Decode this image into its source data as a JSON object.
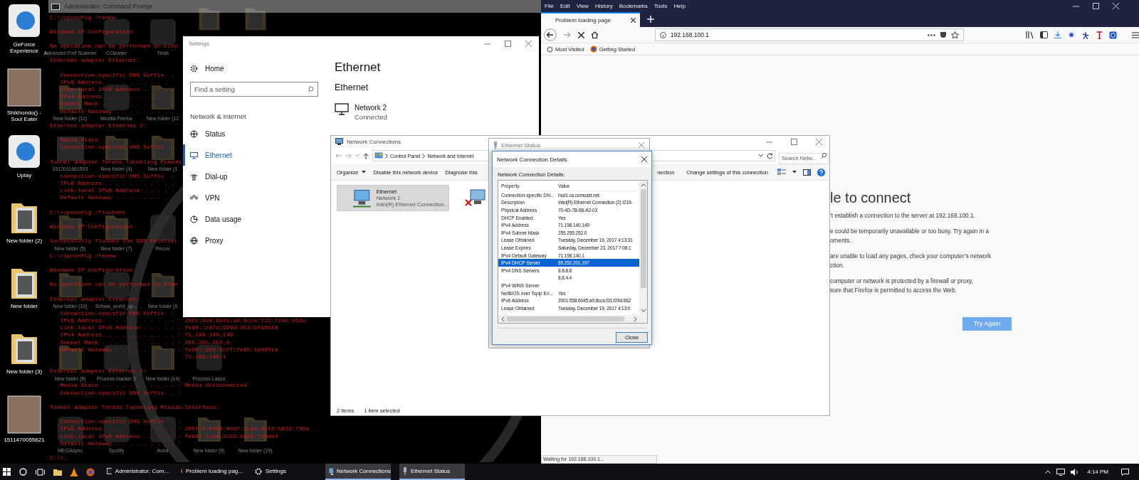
{
  "desktop_icons": [
    {
      "label": "GeForce Experience",
      "kind": "app"
    },
    {
      "label": "Shikhondo() - Soul Eater",
      "kind": "photo"
    },
    {
      "label": "Uplay",
      "kind": "app"
    },
    {
      "label": "New folder (2)",
      "kind": "folder"
    },
    {
      "label": "New folder",
      "kind": "folder"
    },
    {
      "label": "New folder (3)",
      "kind": "folder"
    },
    {
      "label": "1511470055621",
      "kind": "photo"
    }
  ],
  "background_icons": [
    [
      {
        "label": "Advanced Port Scanner",
        "kind": "app"
      },
      {
        "label": "CCleaner",
        "kind": "app"
      },
      {
        "label": "Tixati",
        "kind": "app"
      },
      {
        "kind": "folder"
      },
      {
        "kind": "folder"
      }
    ],
    [
      {
        "label": "New folder (11)",
        "kind": "folder"
      },
      {
        "label": "Mozilla Firefox",
        "kind": "app"
      },
      {
        "label": "New folder (12",
        "kind": "folder"
      }
    ],
    [
      {
        "label": "1512011661593",
        "kind": "photo"
      },
      {
        "label": "New folder (4)",
        "kind": "folder"
      },
      {
        "label": "New folder (1",
        "kind": "folder"
      }
    ],
    [
      {
        "label": "New folder (5)",
        "kind": "folder"
      },
      {
        "label": "New folder (7)",
        "kind": "folder"
      },
      {
        "label": "Recuv",
        "kind": "app"
      }
    ],
    [
      {
        "label": "New folder (10)",
        "kind": "folder"
      },
      {
        "label": "Schwa_world_op...",
        "kind": "app"
      },
      {
        "label": "New folder (6",
        "kind": "folder"
      }
    ],
    [
      {
        "label": "New folder (8)",
        "kind": "folder"
      },
      {
        "label": "Process Hacker 2",
        "kind": "app"
      },
      {
        "label": "New folder (14)",
        "kind": "folder"
      },
      {
        "label": "Process Lasso",
        "kind": "app"
      }
    ],
    [
      {
        "label": "MEGAsync",
        "kind": "app"
      },
      {
        "label": "Spotify",
        "kind": "app"
      },
      {
        "label": "Avira",
        "kind": "app"
      },
      {
        "label": "New folder (9)",
        "kind": "folder"
      },
      {
        "label": "New folder (19)",
        "kind": "folder"
      }
    ]
  ],
  "command_prompt": {
    "title": "Administrator: Command Prompt",
    "blocks": [
      {
        "indented": false,
        "lines": [
          "C:\\>ipconfig /renew"
        ]
      },
      {
        "indented": false,
        "lines": [
          "Windows IP Configuration"
        ]
      },
      {
        "indented": false,
        "lines": [
          "No operation can be performed on Ethe"
        ]
      },
      {
        "indented": false,
        "lines": [
          "Ethernet adapter Ethernet:"
        ]
      },
      {
        "indented": true,
        "lines": [
          "Connection-specific DNS Suffix  .",
          "IPv6 Address. . . . . . . . . .",
          "Link-local IPv6 Address . . . . .",
          "IPv4 Address. . . . . . . . . . .",
          "Subnet Mask . . . . . . . . . . .",
          "Default Gateway . . . . . . . . ."
        ]
      },
      {
        "indented": false,
        "lines": [
          "Ethernet adapter Ethernet 2:"
        ]
      },
      {
        "indented": true,
        "lines": [
          "Media State . . . . . . . . . . .",
          "Connection-specific DNS Suffix  ."
        ]
      },
      {
        "indented": false,
        "lines": [
          "Tunnel adapter Teredo Tunneling Pseudo"
        ]
      },
      {
        "indented": true,
        "lines": [
          "Connection-specific DNS Suffix  .",
          "IPv6 Address. . . . . . . . . . .",
          "Link-local IPv6 Address . . . . .",
          "Default Gateway . . . . . . . . ."
        ]
      },
      {
        "indented": false,
        "lines": [
          "C:\\>ipconfig /flushdns"
        ]
      },
      {
        "indented": false,
        "lines": [
          "Windows IP Configuration"
        ]
      },
      {
        "indented": false,
        "lines": [
          "Successfully flushed the DNS Resolver"
        ]
      },
      {
        "indented": false,
        "lines": [
          "C:\\>ipconfig /renew"
        ]
      },
      {
        "indented": false,
        "lines": [
          "Windows IP Configuration"
        ]
      },
      {
        "indented": false,
        "lines": [
          "No operation can be performed on Ethe"
        ]
      },
      {
        "indented": false,
        "lines": [
          "Ethernet adapter Ethernet:"
        ]
      },
      {
        "indented": true,
        "lines": [
          "Connection-specific DNS Suffix  .",
          "IPv6 Address. . . . . . . . . . . : 2001:558:6045:a9:8cca:f31:f24d:662e",
          "Link-local IPv6 Address . . . . . : fe80::c07d:929d:d54:bfa6%18",
          "IPv4 Address. . . . . . . . . . . : 71.198.140.149",
          "Subnet Mask . . . . . . . . . . . : 255.255.252.0",
          "Default Gateway . . . . . . . . . : fe80::201:5cff:fe65:1a46%18",
          "                                    71.198.140.1"
        ]
      },
      {
        "indented": false,
        "lines": [
          "Ethernet adapter Ethernet 2:"
        ]
      },
      {
        "indented": true,
        "lines": [
          "Media State . . . . . . . . . . . : Media disconnected",
          "Connection-specific DNS Suffix  . :"
        ]
      },
      {
        "indented": false,
        "lines": [
          "Tunnel adapter Teredo Tunneling Pseudo-Interface:"
        ]
      },
      {
        "indented": true,
        "lines": [
          "Connection-specific DNS Suffix  . :",
          "IPv6 Address. . . . . . . . . . . : 2001:0:9d38:90d7:1ca4:2c52:b839:736a",
          "Link-local IPv6 Address . . . . . : fe80::1ca4:2c52:b839:736a%4",
          "Default Gateway . . . . . . . . . :"
        ]
      },
      {
        "indented": false,
        "lines": [
          "C:\\>_"
        ]
      }
    ]
  },
  "settings": {
    "title": "Settings",
    "home": "Home",
    "search_placeholder": "Find a setting",
    "section": "Network & Internet",
    "nav": [
      {
        "label": "Status",
        "kind": "status",
        "selected": false
      },
      {
        "label": "Ethernet",
        "kind": "ethernet",
        "selected": true
      },
      {
        "label": "Dial-up",
        "kind": "dialup",
        "selected": false
      },
      {
        "label": "VPN",
        "kind": "vpn",
        "selected": false
      },
      {
        "label": "Data usage",
        "kind": "data",
        "selected": false
      },
      {
        "label": "Proxy",
        "kind": "proxy",
        "selected": false
      }
    ],
    "heading": "Ethernet",
    "subheading": "Ethernet",
    "network": {
      "name": "Network 2",
      "status": "Connected"
    }
  },
  "network_connections": {
    "title": "Network Connections",
    "path": [
      "Control Panel",
      "Network and Internet"
    ],
    "search_placeholder": "Search Netw...",
    "toolbar": [
      "Organize",
      "Disable this network device",
      "Diagnose this"
    ],
    "toolbar_right": [
      "nection",
      "Change settings of this connection"
    ],
    "items": [
      {
        "kind": "connected",
        "name": "Ethernet",
        "network": "Network 2",
        "adapter": "Intel(R) Ethernet Connection...",
        "selected": true
      },
      {
        "kind": "disconnected",
        "selected": false
      }
    ],
    "status": [
      "2 items",
      "1 item selected"
    ]
  },
  "ethernet_status": {
    "title": "Ethernet Status"
  },
  "details_dialog": {
    "title": "Network Connection Details",
    "label": "Network Connection Details:",
    "columns": [
      "Property",
      "Value"
    ],
    "rows": [
      {
        "property": "Connection-specific DN...",
        "value": "hsd1.ca.comcast.net.",
        "selected": false
      },
      {
        "property": "Description",
        "value": "Intel(R) Ethernet Connection (2) I219-",
        "selected": false
      },
      {
        "property": "Physical Address",
        "value": "70-4D-7B-68-A2-03",
        "selected": false
      },
      {
        "property": "DHCP Enabled",
        "value": "Yes",
        "selected": false
      },
      {
        "property": "IPv4 Address",
        "value": "71.198.140.149",
        "selected": false
      },
      {
        "property": "IPv4 Subnet Mask",
        "value": "255.255.252.0",
        "selected": false
      },
      {
        "property": "Lease Obtained",
        "value": "Tuesday, December 19, 2017 4:13:31",
        "selected": false
      },
      {
        "property": "Lease Expires",
        "value": "Saturday, December 23, 2017 7:08:1",
        "selected": false
      },
      {
        "property": "IPv4 Default Gateway",
        "value": "71.198.140.1",
        "selected": false
      },
      {
        "property": "IPv4 DHCP Server",
        "value": "69.252.201.197",
        "selected": true
      },
      {
        "property": "IPv4 DNS Servers",
        "value": "8.8.8.8",
        "selected": false
      },
      {
        "value": "8.8.4.4",
        "selected": false
      },
      {
        "property": "IPv4 WINS Server",
        "selected": false
      },
      {
        "property": "NetBIOS over Tcpip En...",
        "value": "Yes",
        "selected": false
      },
      {
        "property": "IPv6 Address",
        "value": "2001:558:6045:a9:8cca:f31:f24d:662",
        "selected": false
      },
      {
        "property": "Lease Obtained",
        "value": "Tuesday, December 19, 2017 4:13:0",
        "selected": false
      }
    ],
    "button": "Close"
  },
  "firefox": {
    "menu": [
      "File",
      "Edit",
      "View",
      "History",
      "Bookmarks",
      "Tools",
      "Help"
    ],
    "tabs": [
      {
        "label": "Problem loading page",
        "selected": true
      }
    ],
    "url": "192.168.100.1",
    "bookmarks": [
      "Most Visited",
      "Getting Started"
    ],
    "error_title": "le to connect",
    "error_groups": [
      [
        "’t establish a connection to the server at 192.168.100.1."
      ],
      [
        "e could be temporarily unavailable or too busy. Try again in a",
        "oments."
      ],
      [
        "are unable to load any pages, check your computer’s network",
        "ction."
      ],
      [
        "computer or network is protected by a firewall or proxy,",
        "sure that Firefox is permitted to access the Web."
      ]
    ],
    "button": "Try Again",
    "status": "Waiting for 192.168.100.1..."
  },
  "taskbar": {
    "windows": [
      {
        "kind": "cmd",
        "label": "Administrator: Com...",
        "highlighted": false
      },
      {
        "kind": "firefox",
        "label": "Problem loading pag...",
        "highlighted": false
      },
      {
        "kind": "settings",
        "label": "Settings",
        "highlighted": false
      },
      {
        "kind": "network",
        "label": "Network Connections",
        "highlighted": true
      },
      {
        "kind": "ethernet",
        "label": "Ethernet Status",
        "highlighted": true
      }
    ],
    "time": "4:14 PM"
  }
}
